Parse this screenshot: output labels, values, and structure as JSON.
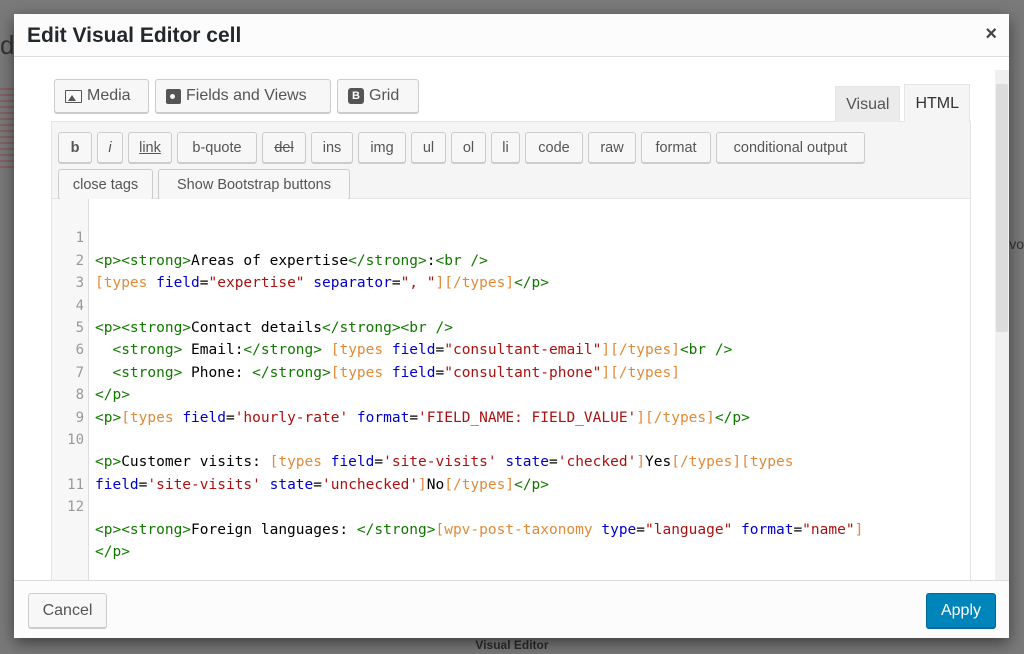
{
  "background": {
    "left_fragment": "d",
    "right_fragment": "vo",
    "bottom_label": "Visual Editor"
  },
  "dialog": {
    "title": "Edit Visual Editor cell",
    "close_label": "×"
  },
  "media_buttons": {
    "media": "Media",
    "fields_and_views": "Fields and Views",
    "grid": "Grid",
    "grid_icon_letter": "B"
  },
  "tabs": {
    "visual": "Visual",
    "html": "HTML",
    "active": "HTML"
  },
  "quicktags": [
    "b",
    "i",
    "link",
    "b-quote",
    "del",
    "ins",
    "img",
    "ul",
    "ol",
    "li",
    "code",
    "raw",
    "format",
    "conditional output",
    "close tags",
    "Show Bootstrap buttons"
  ],
  "code": {
    "line_numbers": [
      "1",
      "2",
      "3",
      "4",
      "5",
      "6",
      "7",
      "8",
      "9",
      "10",
      "",
      "11",
      "12",
      ""
    ],
    "l1": {
      "a": "<p><strong>",
      "b": "Areas of expertise",
      "c": "</strong>",
      "d": ":",
      "e": "<br />"
    },
    "l2": {
      "a": "[types ",
      "b": "field",
      "c": "=",
      "d": "\"expertise\"",
      "e": " separator",
      "f": "=",
      "g": "\", \"",
      "h": "][/types]",
      "i": "</p>"
    },
    "l4": {
      "a": "<p><strong>",
      "b": "Contact details",
      "c": "</strong><br />"
    },
    "l5": {
      "a": "  ",
      "b": "<strong>",
      "c": " Email:",
      "d": "</strong>",
      "e": " ",
      "f": "[types ",
      "g": "field",
      "h": "=",
      "i": "\"consultant-email\"",
      "j": "][/types]",
      "k": "<br />"
    },
    "l6": {
      "a": "  ",
      "b": "<strong>",
      "c": " Phone: ",
      "d": "</strong>",
      "e": "[types ",
      "f": "field",
      "g": "=",
      "h": "\"consultant-phone\"",
      "i": "][/types]"
    },
    "l7": {
      "a": "</p>"
    },
    "l8": {
      "a": "<p>",
      "b": "[types ",
      "c": "field",
      "d": "=",
      "e": "'hourly-rate'",
      "f": " format",
      "g": "=",
      "h": "'FIELD_NAME: FIELD_VALUE'",
      "i": "][/types]",
      "j": "</p>"
    },
    "l10": {
      "a": "<p>",
      "b": "Customer visits: ",
      "c": "[types ",
      "d": "field",
      "e": "=",
      "f": "'site-visits'",
      "g": " state",
      "h": "=",
      "i": "'checked'",
      "j": "]",
      "k": "Yes",
      "l": "[/types][types"
    },
    "l10b": {
      "a": "field",
      "b": "=",
      "c": "'site-visits'",
      "d": " state",
      "e": "=",
      "f": "'unchecked'",
      "g": "]",
      "h": "No",
      "i": "[/types]",
      "j": "</p>"
    },
    "l12": {
      "a": "<p><strong>",
      "b": "Foreign languages: ",
      "c": "</strong>",
      "d": "[wpv-post-taxonomy ",
      "e": "type",
      "f": "=",
      "g": "\"language\"",
      "h": " format",
      "i": "=",
      "j": "\"name\"",
      "k": "]"
    },
    "l12b": {
      "a": "</p>"
    }
  },
  "footer": {
    "cancel": "Cancel",
    "apply": "Apply"
  },
  "colors": {
    "primary_button": "#0085ba",
    "tag": "#117700",
    "shortcode": "#e08a3a",
    "attribute": "#0000cc",
    "string": "#aa1111"
  }
}
